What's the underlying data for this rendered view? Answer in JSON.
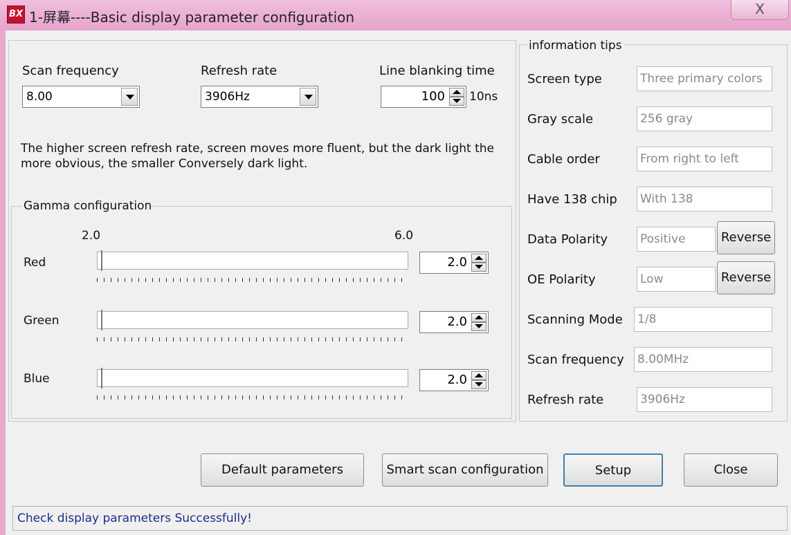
{
  "window": {
    "icon_text": "BX",
    "title": "1-屏幕----Basic display parameter configuration",
    "close_label": "X"
  },
  "scan": {
    "label": "Scan frequency",
    "value": "8.00"
  },
  "refresh": {
    "label": "Refresh rate",
    "value": "3906Hz"
  },
  "blanking": {
    "label": "Line blanking time",
    "value": "100",
    "unit": "10ns"
  },
  "description": "The higher screen refresh rate, screen moves more fluent, but the dark light the more obvious, the smaller Conversely dark light.",
  "gamma": {
    "legend": "Gamma configuration",
    "min_label": "2.0",
    "max_label": "6.0",
    "min": 2.0,
    "max": 6.0,
    "channels": [
      {
        "label": "Red",
        "value": "2.0"
      },
      {
        "label": "Green",
        "value": "2.0"
      },
      {
        "label": "Blue",
        "value": "2.0"
      }
    ]
  },
  "info": {
    "legend": "information tips",
    "rows": [
      {
        "label": "Screen type",
        "value": "Three primary colors"
      },
      {
        "label": "Gray scale",
        "value": "256 gray"
      },
      {
        "label": "Cable order",
        "value": "From right to left"
      },
      {
        "label": "Have 138 chip",
        "value": "With 138"
      },
      {
        "label": "Data Polarity",
        "value": "Positive",
        "button": "Reverse"
      },
      {
        "label": "OE Polarity",
        "value": "Low",
        "button": "Reverse"
      },
      {
        "label": "Scanning Mode",
        "value": "1/8"
      },
      {
        "label": "Scan frequency",
        "value": "8.00MHz"
      },
      {
        "label": "Refresh rate",
        "value": "3906Hz"
      }
    ]
  },
  "buttons": {
    "default_params": "Default parameters",
    "smart_scan": "Smart scan configuration",
    "setup": "Setup",
    "close": "Close"
  },
  "status": "Check display parameters Successfully!"
}
